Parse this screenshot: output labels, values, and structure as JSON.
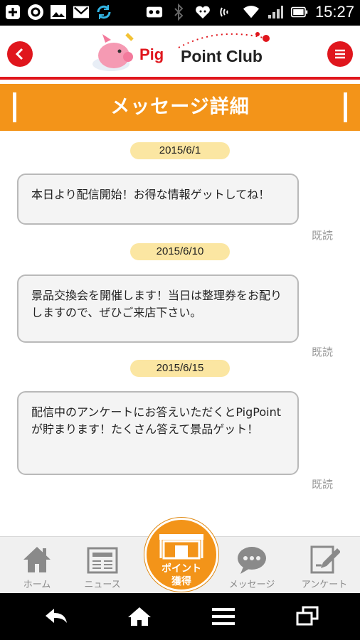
{
  "status_bar": {
    "time": "15:27",
    "icons": [
      "add-box-icon",
      "circle-a-icon",
      "image-icon",
      "gmail-icon",
      "sync-icon",
      "voicemail-icon",
      "bluetooth-icon",
      "heart-smile-icon",
      "nfc-icon",
      "wifi-icon",
      "signal-icon",
      "battery-icon"
    ]
  },
  "header": {
    "logo_pig": "Pig",
    "logo_club": "Point Club",
    "back_icon": "chevron-left-icon",
    "menu_icon": "menu-icon",
    "accent": "#e0161d"
  },
  "title": "メッセージ詳細",
  "messages": [
    {
      "date": "2015/6/1",
      "text": "本日より配信開始！お得な情報ゲットしてね！",
      "status": "既読"
    },
    {
      "date": "2015/6/10",
      "text": "景品交換会を開催します！当日は整理券をお配りしますので、ぜひご来店下さい。",
      "status": "既読"
    },
    {
      "date": "2015/6/15",
      "text": "配信中のアンケートにお答えいただくとPigPointが貯まります！たくさん答えて景品ゲット！",
      "status": "既読"
    }
  ],
  "bottom_nav": {
    "home": "ホーム",
    "news": "ニュース",
    "point_line1": "ポイント",
    "point_line2": "獲得",
    "message": "メッセージ",
    "survey": "アンケート",
    "accent": "#f39419"
  },
  "system_nav": [
    "back-icon",
    "home-icon",
    "menu-icon",
    "recents-icon"
  ]
}
